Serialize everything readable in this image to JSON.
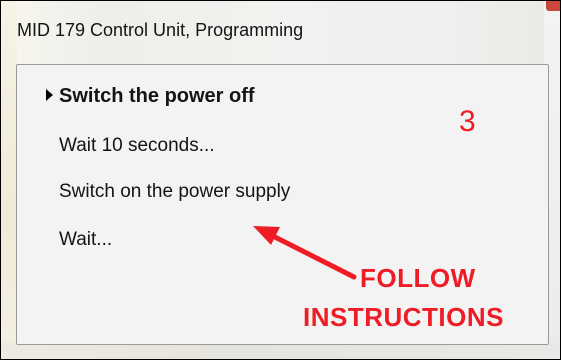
{
  "window": {
    "title": "MID 179 Control Unit, Programming"
  },
  "steps": [
    {
      "label": "Switch the power off",
      "active": true
    },
    {
      "label": "Wait 10 seconds...",
      "active": false
    },
    {
      "label": "Switch on the power supply",
      "active": false
    },
    {
      "label": "Wait...",
      "active": false
    }
  ],
  "annotation": {
    "step_number": "3",
    "line1": "FOLLOW",
    "line2": "INSTRUCTIONS",
    "color": "#ee1c24"
  },
  "icons": {
    "current_step": "triangle-right-icon",
    "annotation_arrow": "arrow-icon"
  }
}
